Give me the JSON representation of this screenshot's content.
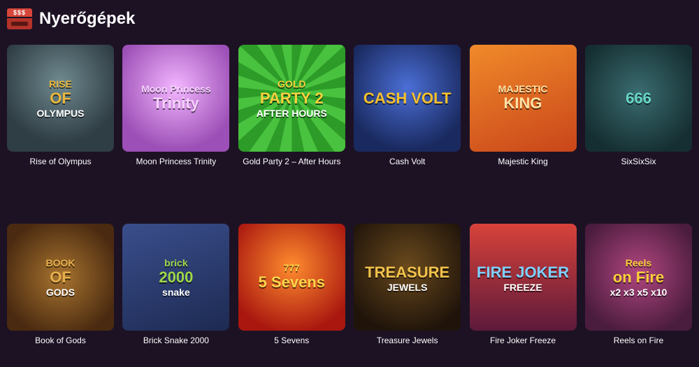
{
  "header": {
    "title": "Nyerőgépek",
    "icon": "slot-machine-icon",
    "icon_text": "$$$"
  },
  "games": [
    {
      "title": "Rise of Olympus",
      "logo_line1": "RISE",
      "logo_line2": "OF",
      "logo_line3": "OLYMPUS",
      "bg": "#3c4b53",
      "accent": "#e9b73c"
    },
    {
      "title": "Moon Princess Trinity",
      "logo_line1": "Moon Princess",
      "logo_line2": "Trinity",
      "logo_line3": "",
      "bg": "#b06bc4",
      "accent": "#f6d1ff"
    },
    {
      "title": "Gold Party 2 – After Hours",
      "logo_line1": "GOLD",
      "logo_line2": "PARTY 2",
      "logo_line3": "AFTER HOURS",
      "bg": "#33a02b",
      "accent": "#f7d23c"
    },
    {
      "title": "Cash Volt",
      "logo_line1": "",
      "logo_line2": "CASH VOLT",
      "logo_line3": "",
      "bg": "#1f3a78",
      "accent": "#f6c12e"
    },
    {
      "title": "Majestic King",
      "logo_line1": "MAJESTIC",
      "logo_line2": "KING",
      "logo_line3": "",
      "bg": "#e5651f",
      "accent": "#ffe1a3"
    },
    {
      "title": "SixSixSix",
      "logo_line1": "",
      "logo_line2": "666",
      "logo_line3": "",
      "bg": "#1f4447",
      "accent": "#67d6c6"
    },
    {
      "title": "Book of Gods",
      "logo_line1": "BOOK",
      "logo_line2": "OF",
      "logo_line3": "GODS",
      "bg": "#6b4420",
      "accent": "#e7b04c"
    },
    {
      "title": "Brick Snake 2000",
      "logo_line1": "brick",
      "logo_line2": "2000",
      "logo_line3": "snake",
      "bg": "#2f3f73",
      "accent": "#9ed64a"
    },
    {
      "title": "5 Sevens",
      "logo_line1": "777",
      "logo_line2": "5 Sevens",
      "logo_line3": "",
      "bg": "#b3261a",
      "accent": "#ffd34a"
    },
    {
      "title": "Treasure Jewels",
      "logo_line1": "",
      "logo_line2": "TREASURE",
      "logo_line3": "JEWELS",
      "bg": "#3b2412",
      "accent": "#f0c24b"
    },
    {
      "title": "Fire Joker Freeze",
      "logo_line1": "",
      "logo_line2": "FIRE JOKER",
      "logo_line3": "FREEZE",
      "bg": "#c0332a",
      "accent": "#7fd0ff"
    },
    {
      "title": "Reels on Fire",
      "logo_line1": "Reels",
      "logo_line2": "on Fire",
      "logo_line3": "x2 x3 x5 x10",
      "bg": "#6d2b57",
      "accent": "#ffcf3a"
    }
  ]
}
